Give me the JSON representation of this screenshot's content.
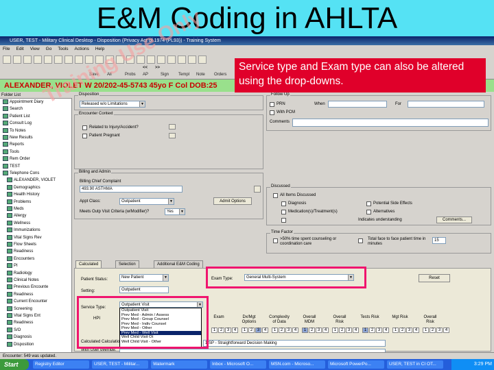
{
  "slide": {
    "title": "E&M Coding in AHLTA"
  },
  "window": {
    "title": "USER, TEST - Military Clinical Desktop - Disposition (Privacy Act of 1974 (PL93)) - Training System"
  },
  "menu": [
    "File",
    "Edit",
    "View",
    "Go",
    "Tools",
    "Actions",
    "Help"
  ],
  "toolbar": {
    "save_label": "Save",
    "sign_label": "Sign",
    "nav_back": "<<",
    "nav_forward": ">>",
    "items": [
      "Save",
      "All",
      "Probs",
      "AP",
      "Sign",
      "Templ",
      "Note",
      "Orders"
    ]
  },
  "watermark": "Training Use Only",
  "patient_banner": "ALEXANDER, VIOLET W  20/202-45-5743  45yo  F  Col  DOB:25",
  "callout": {
    "text": "Service type and Exam type can also be altered using the drop-downs."
  },
  "folder_list": {
    "header": "Folder List",
    "items": [
      "Appointment Diary",
      "Search",
      "Patient List",
      "Consult Log",
      "To Notes",
      "New Results",
      "Reports",
      "Tools",
      "Rem Order",
      "TEST",
      "Telephone Cons",
      "ALEXANDER, VIOLET",
      "Demographics",
      "Health History",
      "Problems",
      "Meds",
      "Allergy",
      "Wellness",
      "Immunizations",
      "Vital Signs Rev",
      "Flow Sheets",
      "Readiness",
      "Encounters",
      "PI",
      "Radiology",
      "Clinical Notes",
      "Previous Encounte",
      "Readiness",
      "Current Encounter",
      "Screening",
      "Vital Signs Ent",
      "Readiness",
      "S/O",
      "Diagnosis",
      "Disposition"
    ]
  },
  "disposition": {
    "group_label": "Disposition",
    "value": "Released w/o Limitations",
    "encounter_context_label": "Encounter Context",
    "injury_label": "Related to Injury/Accident?",
    "pregnant_label": "Patient Pregnant",
    "billing_label": "Billing and Admin",
    "chief_complaint_label": "Billing Chief Complaint",
    "chief_complaint_value": "493.90 ASTHMA",
    "appt_class_label": "Appt Class:",
    "appt_class_value": "Outpatient",
    "admit_button": "Admit Options",
    "outp_visit_label": "Meets Outp Visit Criteria (w/Modifier)?",
    "outp_visit_value": "Yes"
  },
  "follow_up": {
    "group_label": "Follow Up",
    "prn": "PRN",
    "with_pcm": "With PCM",
    "when_label": "When",
    "for_label": "For",
    "comments_label": "Comments"
  },
  "discussed": {
    "group_label": "Discussed",
    "all_items": "All Items Discussed",
    "diagnosis": "Diagnosis",
    "medications": "Medication(s)/Treatment(s)",
    "potential_side_effects": "Potential Side Effects",
    "alternatives": "Alternatives",
    "understanding": "Indicates understanding",
    "comments_button": "Comments..."
  },
  "time_factor": {
    "group_label": "Time Factor",
    "counseling_text": ">50% time spent counseling or coordination care",
    "total_face_text": "Total face to face patient time in minutes",
    "minutes": "15"
  },
  "em_tabs": [
    "Calculated",
    "Selection",
    "Additional E&M Coding"
  ],
  "em": {
    "patient_status_label": "Patient Status:",
    "patient_status_value": "New Patient",
    "setting_label": "Setting:",
    "setting_value": "Outpatient",
    "service_type_label": "Service Type:",
    "service_type_value": "Outpatient Visit",
    "exam_type_label": "Exam Type:",
    "exam_type_value": "General Multi-System",
    "reset_button": "Reset",
    "hpi_label": "HPI",
    "calc_label": "Calculated Calculation:",
    "calc_value": "1 SP - Straightforward Decision Making",
    "override_label": "With User override:",
    "columns": [
      "Exam",
      "Dx/Mgt Options",
      "Complexity of Data",
      "Overall MDM",
      "Overall Risk",
      "Tests Risk",
      "Mgt Risk",
      "Overall Risk"
    ],
    "service_options": [
      "Outpatient Visit",
      "Prev Med - Admin / Assess",
      "Prev Med - Group Counsel",
      "Prev Med - Indiv Counsel",
      "Prev Med - Other",
      "Prev Med - Well Visit",
      "Well Child Visit Ot",
      "Well Child Visit - Other"
    ],
    "highlighted_option": 5
  },
  "statusbar": "Encounter: 549 was updated.",
  "taskbar": {
    "start": "Start",
    "tasks": [
      "Registry Editor",
      "USER, TEST - Militar...",
      "Watermark",
      "Inbox - Microsoft O...",
      "MSN.com - Microso...",
      "Microsoft PowerPo...",
      "USER, TEST in CI  OT..."
    ],
    "clock": "3:29 PM"
  }
}
